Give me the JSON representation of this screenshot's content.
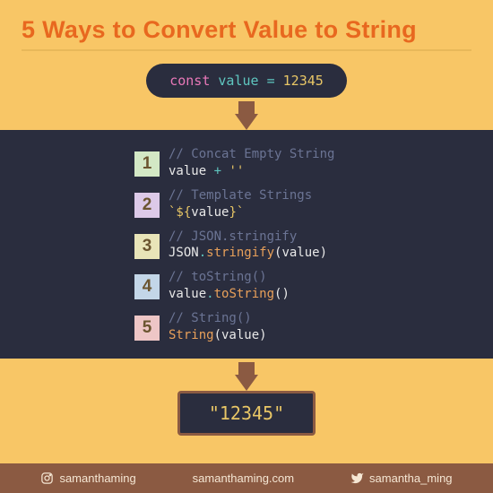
{
  "title": "5 Ways to Convert Value to String",
  "declaration": {
    "kw": "const",
    "name": "value",
    "eq": "=",
    "val": "12345"
  },
  "methods": [
    {
      "comment": "// Concat Empty String",
      "parts": [
        {
          "t": "value ",
          "c": "white"
        },
        {
          "t": "+ ",
          "c": "teal"
        },
        {
          "t": "''",
          "c": "yellow"
        }
      ]
    },
    {
      "comment": "// Template Strings",
      "parts": [
        {
          "t": "`${",
          "c": "yellow"
        },
        {
          "t": "value",
          "c": "white"
        },
        {
          "t": "}`",
          "c": "yellow"
        }
      ]
    },
    {
      "comment": "// JSON.stringify",
      "parts": [
        {
          "t": "JSON",
          "c": "white"
        },
        {
          "t": ".",
          "c": "teal"
        },
        {
          "t": "stringify",
          "c": "orange"
        },
        {
          "t": "(value)",
          "c": "white"
        }
      ]
    },
    {
      "comment": "// toString()",
      "parts": [
        {
          "t": "value",
          "c": "white"
        },
        {
          "t": ".",
          "c": "teal"
        },
        {
          "t": "toString",
          "c": "orange"
        },
        {
          "t": "()",
          "c": "white"
        }
      ]
    },
    {
      "comment": "// String()",
      "parts": [
        {
          "t": "String",
          "c": "orange"
        },
        {
          "t": "(value)",
          "c": "white"
        }
      ]
    }
  ],
  "result": "\"12345\"",
  "footer": {
    "ig": "samanthaming",
    "web": "samanthaming.com",
    "tw": "samantha_ming"
  }
}
